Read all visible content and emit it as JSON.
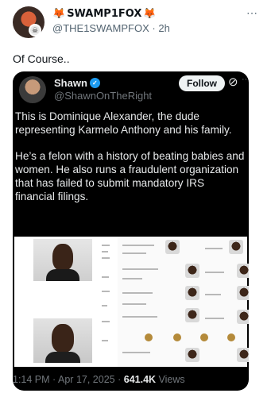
{
  "tweet": {
    "display_name": "SWAMP1FOX",
    "name_emoji_left": "🦊",
    "name_emoji_right": "🦊",
    "handle": "@THE1SWAMPFOX",
    "time": "2h",
    "separator": "·",
    "text": "Of Course..",
    "more_icon": "more-horizontal-icon"
  },
  "embed": {
    "display_name": "Shawn",
    "verified_icon": "verified-badge-icon",
    "handle": "@ShawnOnTheRight",
    "follow_label": "Follow",
    "body_paragraphs": [
      "This is Dominique Alexander, the dude representing Karmelo Anthony and his family.",
      "He’s a felon with a history of beating babies and women.  He also runs a fraudulent organization that has failed to submit mandatory IRS financial filings."
    ],
    "footer": {
      "time": "1:14 PM",
      "separator1": "·",
      "date": "Apr 17, 2025",
      "separator2": "·",
      "views_count": "641.4K",
      "views_label": "Views"
    }
  },
  "colors": {
    "accent_blue": "#1d9bf0",
    "embed_background": "#000000",
    "muted_text": "#536471"
  }
}
